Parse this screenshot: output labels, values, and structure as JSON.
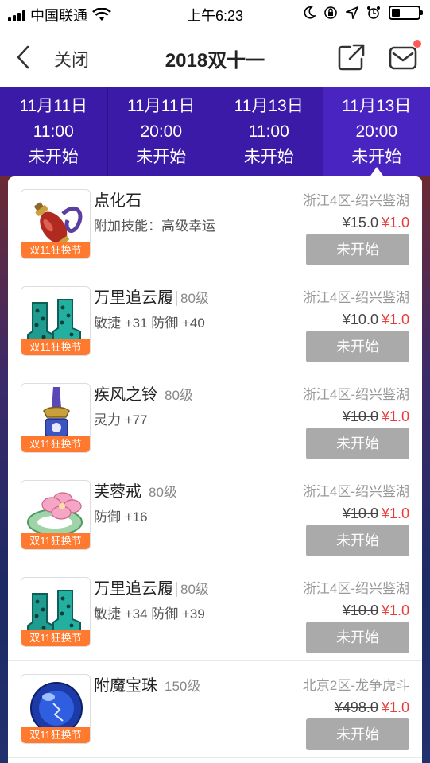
{
  "status_bar": {
    "carrier": "中国联通",
    "time": "上午6:23"
  },
  "nav": {
    "close_label": "关闭",
    "title": "2018双十一"
  },
  "tabs": [
    {
      "date": "11月11日",
      "time": "11:00",
      "status": "未开始"
    },
    {
      "date": "11月11日",
      "time": "20:00",
      "status": "未开始"
    },
    {
      "date": "11月13日",
      "time": "11:00",
      "status": "未开始"
    },
    {
      "date": "11月13日",
      "time": "20:00",
      "status": "未开始"
    }
  ],
  "items": [
    {
      "name": "点化石",
      "level": "",
      "attr": "附加技能：高级幸运",
      "server": "浙江4区-绍兴鉴湖",
      "old_price": "¥15.0",
      "new_price": "¥1.0",
      "button": "未开始",
      "badge": "双11狂换节",
      "icon": "gourd-icon"
    },
    {
      "name": "万里追云履",
      "level": "80级",
      "attr": "敏捷 +31 防御 +40",
      "server": "浙江4区-绍兴鉴湖",
      "old_price": "¥10.0",
      "new_price": "¥1.0",
      "button": "未开始",
      "badge": "双11狂换节",
      "icon": "boots-icon"
    },
    {
      "name": "疾风之铃",
      "level": "80级",
      "attr": "灵力 +77",
      "server": "浙江4区-绍兴鉴湖",
      "old_price": "¥10.0",
      "new_price": "¥1.0",
      "button": "未开始",
      "badge": "双11狂换节",
      "icon": "bell-icon"
    },
    {
      "name": "芙蓉戒",
      "level": "80级",
      "attr": "防御 +16",
      "server": "浙江4区-绍兴鉴湖",
      "old_price": "¥10.0",
      "new_price": "¥1.0",
      "button": "未开始",
      "badge": "双11狂换节",
      "icon": "lotus-ring-icon"
    },
    {
      "name": "万里追云履",
      "level": "80级",
      "attr": "敏捷 +34 防御 +39",
      "server": "浙江4区-绍兴鉴湖",
      "old_price": "¥10.0",
      "new_price": "¥1.0",
      "button": "未开始",
      "badge": "双11狂换节",
      "icon": "boots-icon"
    },
    {
      "name": "附魔宝珠",
      "level": "150级",
      "attr": "",
      "server": "北京2区-龙争虎斗",
      "old_price": "¥498.0",
      "new_price": "¥1.0",
      "button": "未开始",
      "badge": "双11狂换节",
      "icon": "orb-icon"
    }
  ],
  "colors": {
    "accent_purple": "#3a1aa6",
    "price_red": "#e83c3c",
    "badge_orange": "#ff7a2e",
    "button_gray": "#aaaaaa"
  }
}
